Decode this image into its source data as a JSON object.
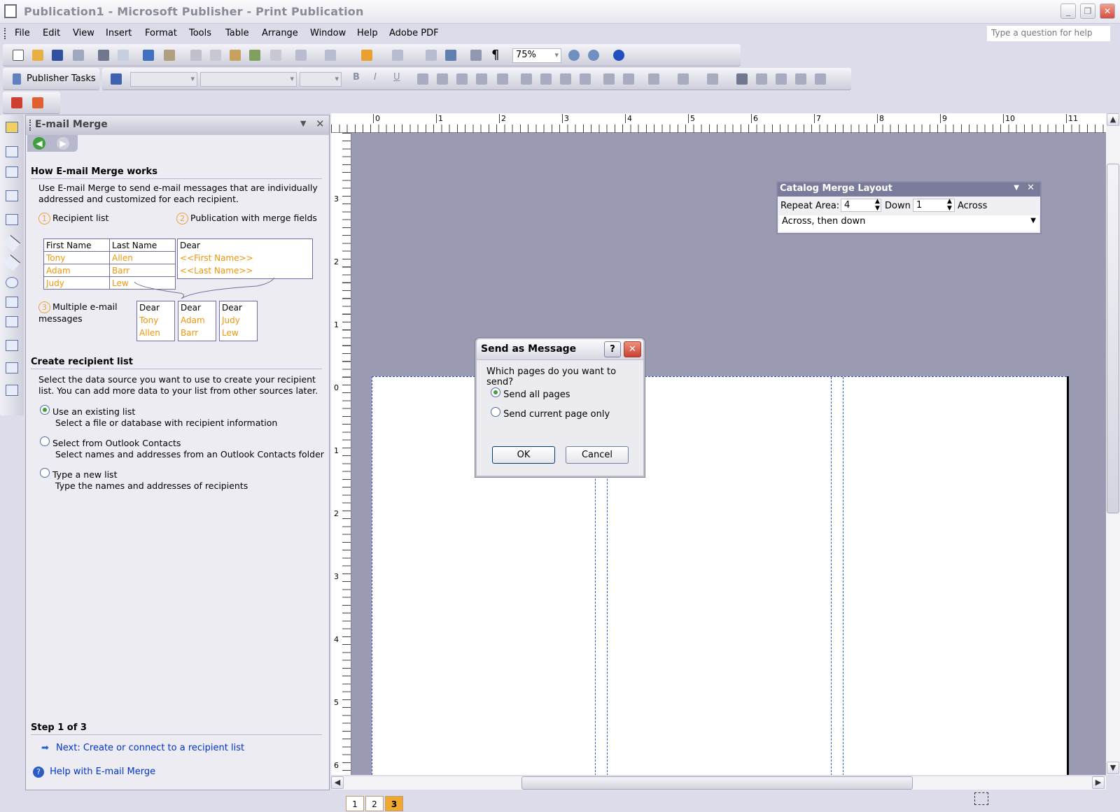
{
  "window": {
    "title": "Publication1 - Microsoft Publisher - Print Publication"
  },
  "menu": [
    "File",
    "Edit",
    "View",
    "Insert",
    "Format",
    "Tools",
    "Table",
    "Arrange",
    "Window",
    "Help",
    "Adobe PDF"
  ],
  "help_placeholder": "Type a question for help",
  "toolbar": {
    "zoom": "75%",
    "publisher_tasks": "Publisher Tasks"
  },
  "task_pane": {
    "title": "E-mail Merge",
    "how_heading": "How E-mail Merge works",
    "how_text": "Use E-mail Merge to send e-mail messages that are individually addressed and customized for each recipient.",
    "step1": "Recipient list",
    "step2": "Publication with merge fields",
    "step3": "Multiple e-mail messages",
    "table_headers": [
      "First Name",
      "Last Name"
    ],
    "table_rows": [
      [
        "Tony",
        "Allen"
      ],
      [
        "Adam",
        "Barr"
      ],
      [
        "Judy",
        "Lew"
      ]
    ],
    "merge_doc": {
      "greeting": "Dear",
      "field1": "<<First Name>>",
      "field2": "<<Last Name>>"
    },
    "messages": [
      {
        "greeting": "Dear",
        "first": "Tony",
        "last": "Allen"
      },
      {
        "greeting": "Dear",
        "first": "Adam",
        "last": "Barr"
      },
      {
        "greeting": "Dear",
        "first": "Judy",
        "last": "Lew"
      }
    ],
    "create_heading": "Create recipient list",
    "create_text": "Select the data source you want to use to create your recipient list. You can add more data to your list from other sources later.",
    "options": [
      {
        "label": "Use an existing list",
        "desc": "Select a file or database with recipient information",
        "selected": true
      },
      {
        "label": "Select from Outlook Contacts",
        "desc": "Select names and addresses from an Outlook Contacts folder",
        "selected": false
      },
      {
        "label": "Type a new list",
        "desc": "Type the names and addresses of recipients",
        "selected": false
      }
    ],
    "step_label": "Step 1 of 3",
    "next_link": "Next: Create or connect to a recipient list",
    "help_link": "Help with E-mail Merge"
  },
  "ruler": {
    "h": [
      "0",
      "1",
      "2",
      "3",
      "4",
      "5",
      "6",
      "7",
      "8",
      "9",
      "10",
      "11"
    ],
    "v": [
      "3",
      "2",
      "1",
      "0",
      "1",
      "2",
      "3",
      "4",
      "5",
      "6"
    ]
  },
  "catalog": {
    "title": "Catalog Merge Layout",
    "repeat_label": "Repeat Area:",
    "down_value": "4",
    "down_label": "Down",
    "across_value": "1",
    "across_label": "Across",
    "order": "Across, then down"
  },
  "dialog": {
    "title": "Send as Message",
    "question": "Which pages do you want to send?",
    "options": [
      {
        "label": "Send all pages",
        "selected": true
      },
      {
        "label": "Send current page only",
        "selected": false
      }
    ],
    "ok": "OK",
    "cancel": "Cancel"
  },
  "pages": [
    "1",
    "2",
    "3"
  ],
  "current_page": "3",
  "colors": {
    "canvas": "#9a9ab2",
    "merge_field": "#f0960a",
    "link": "#0033cc"
  }
}
